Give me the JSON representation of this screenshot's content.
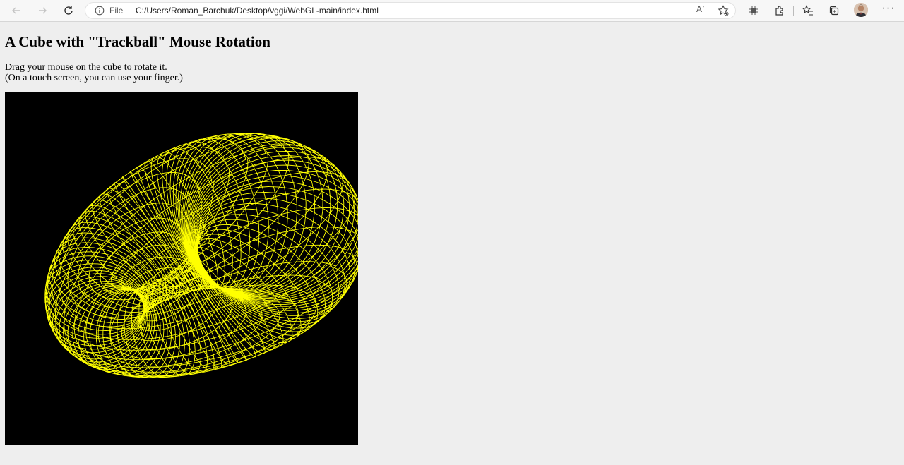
{
  "browser": {
    "file_label": "File",
    "url": "C:/Users/Roman_Barchuk/Desktop/vggi/WebGL-main/index.html",
    "read_aloud_label": "Aʾ",
    "icons": [
      "back-icon",
      "forward-icon",
      "refresh-icon",
      "info-icon",
      "read-aloud-icon",
      "add-favorite-icon",
      "extension-icon",
      "extensions-icon",
      "favorites-icon",
      "collections-icon",
      "profile-avatar",
      "more-icon"
    ]
  },
  "page": {
    "title": "A Cube with \"Trackball\" Mouse Rotation",
    "instruction_line1": "Drag your mouse on the cube to rotate it.",
    "instruction_line2": "(On a touch screen, you can use your finger.)"
  },
  "canvas": {
    "background": "#000000",
    "line_color": "#ffff00",
    "shape": "wireframe surface of revolution (torus-like), yellow lines on black"
  },
  "colors": {
    "page_background": "#eeeeee",
    "toolbar_background": "#f7f7f7"
  }
}
